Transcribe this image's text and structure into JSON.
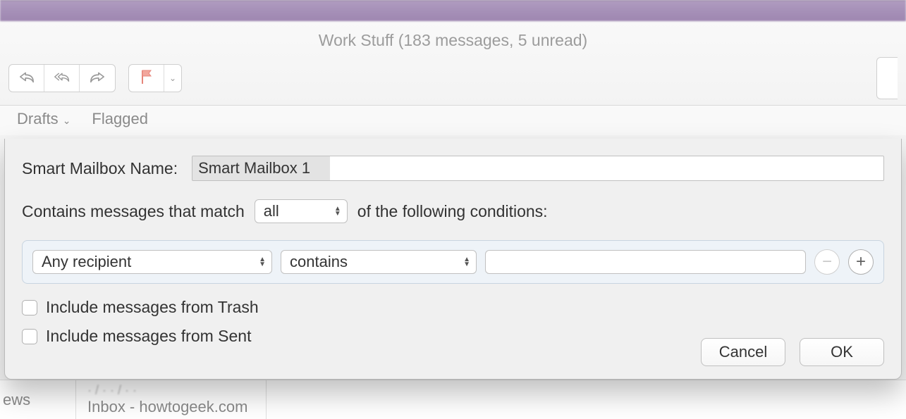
{
  "window": {
    "title": "Work Stuff (183 messages, 5 unread)"
  },
  "favorites": {
    "drafts": "Drafts",
    "flagged": "Flagged"
  },
  "sheet": {
    "name_label": "Smart Mailbox Name:",
    "name_value": "Smart Mailbox 1",
    "match_prefix": "Contains messages that match",
    "match_mode": "all",
    "match_suffix": "of the following conditions:",
    "condition": {
      "field": "Any recipient",
      "op": "contains",
      "value": ""
    },
    "include_trash": "Include messages from Trash",
    "include_sent": "Include messages from Sent",
    "cancel": "Cancel",
    "ok": "OK"
  },
  "background": {
    "col1": "ews",
    "line2": "Inbox - howtogeek.com"
  }
}
